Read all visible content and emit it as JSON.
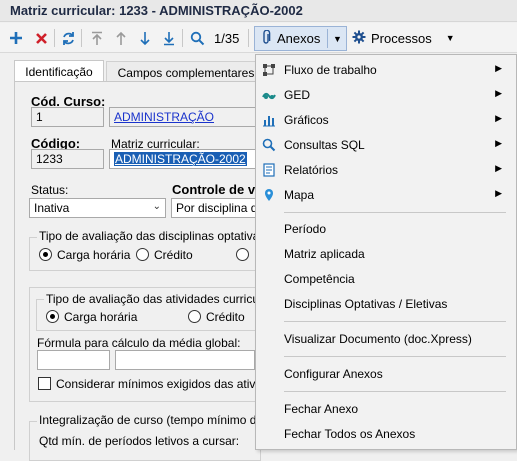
{
  "window": {
    "title": "Matriz curricular: 1233 - ADMINISTRAÇÃO-2002"
  },
  "toolbar": {
    "record_position": "1/35",
    "anexos_label": "Anexos",
    "processos_label": "Processos",
    "icons": [
      "plus-icon",
      "delete-x-icon",
      "refresh-icon",
      "first-record-icon",
      "previous-record-icon",
      "next-record-icon",
      "last-record-icon",
      "search-icon",
      "paperclip-icon",
      "gear-icon"
    ]
  },
  "tabs": {
    "identificacao": "Identificação",
    "campos": "Campos complementares"
  },
  "form": {
    "cod_curso_label": "Cód. Curso:",
    "cod_curso_value": "1",
    "curso_name": "ADMINISTRAÇÃO",
    "codigo_label": "Código:",
    "codigo_value": "1233",
    "matriz_label": "Matriz curricular:",
    "matriz_value": "ADMINISTRAÇÃO-2002",
    "status_label": "Status:",
    "status_value": "Inativa",
    "controle_label": "Controle de va",
    "controle_value": "Por disciplina da",
    "optativas_group": "Tipo de avaliação das disciplinas optativas",
    "opt_carga": "Carga horária",
    "opt_credito": "Crédito",
    "atividades_group": "Tipo de avaliação das atividades curriculare",
    "atv_carga": "Carga horária",
    "atv_credito": "Crédito",
    "formula_label": "Fórmula para cálculo da média global:",
    "considerar_label": "Considerar mínimos exigidos das atividade",
    "integralizacao_group": "Integralização de curso (tempo mínimo do cur",
    "qtd_label": "Qtd mín. de períodos letivos a cursar:"
  },
  "anexos_menu": {
    "items": [
      {
        "label": "Fluxo de trabalho",
        "icon": "workflow-icon",
        "submenu": true
      },
      {
        "label": "GED",
        "icon": "ged-icon",
        "submenu": true
      },
      {
        "label": "Gráficos",
        "icon": "bar-chart-icon",
        "submenu": true
      },
      {
        "label": "Consultas SQL",
        "icon": "sql-search-icon",
        "submenu": true
      },
      {
        "label": "Relatórios",
        "icon": "report-icon",
        "submenu": true
      },
      {
        "label": "Mapa",
        "icon": "map-pin-icon",
        "submenu": true
      },
      {
        "label": "Período"
      },
      {
        "label": "Matriz aplicada"
      },
      {
        "label": "Competência"
      },
      {
        "label": "Disciplinas Optativas / Eletivas"
      },
      {
        "label": "Visualizar Documento (doc.Xpress)"
      },
      {
        "label": "Configurar Anexos"
      },
      {
        "label": "Fechar Anexo"
      },
      {
        "label": "Fechar Todos os Anexos"
      }
    ]
  },
  "colors": {
    "accent": "#1a5fb4",
    "link": "#1a33cc",
    "active_button": "#dbe6f4"
  }
}
